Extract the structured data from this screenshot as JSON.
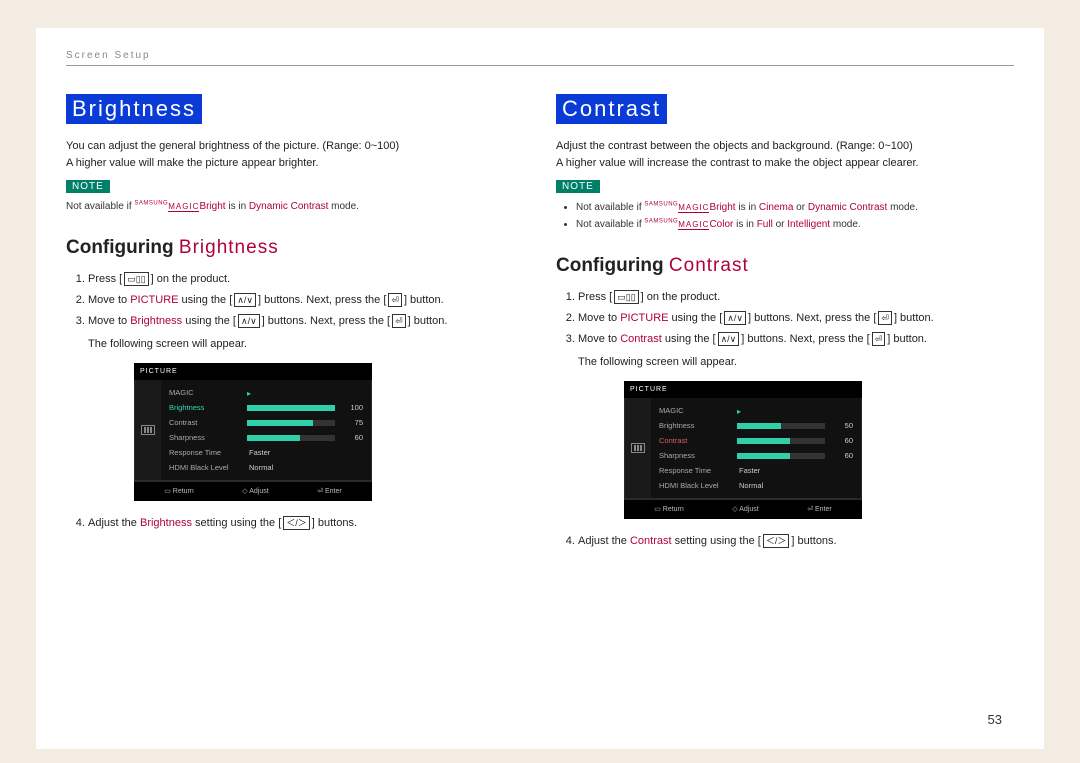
{
  "breadcrumb": "Screen Setup",
  "page_number": "53",
  "left": {
    "title": "Brightness",
    "desc1": "You can adjust the general brightness of the picture. (Range: 0~100)",
    "desc2": "A higher value will make the picture appear brighter.",
    "note_label": "NOTE",
    "note_prefix": "Not available if ",
    "note_samsung": "SAMSUNG",
    "note_magic": "MAGIC",
    "note_bright": "Bright",
    "note_mid": " is in ",
    "note_mode1": "Dynamic Contrast",
    "note_suffix": " mode.",
    "subhead_cfg": "Configuring ",
    "subhead_acc": "Brightness",
    "step1a": "Press [",
    "step1b": "] on the product.",
    "step2a": "Move to ",
    "step2_picture": "PICTURE",
    "step2b": " using the [",
    "step2c": "] buttons. Next, press the [",
    "step2d": "] button.",
    "step3a": "Move to ",
    "step3_target": "Brightness",
    "step3b": " using the [",
    "step3c": "] buttons. Next, press the [",
    "step3d": "] button.",
    "step3_sub": "The following screen will appear.",
    "step4a": "Adjust the ",
    "step4_target": "Brightness",
    "step4b": " setting using the [",
    "step4c": "] buttons.",
    "osd": {
      "header": "PICTURE",
      "rows": [
        {
          "label": "MAGIC",
          "type": "arrow"
        },
        {
          "label": "Brightness",
          "type": "bar",
          "value": 100,
          "highlight": true
        },
        {
          "label": "Contrast",
          "type": "bar",
          "value": 75
        },
        {
          "label": "Sharpness",
          "type": "bar",
          "value": 60
        },
        {
          "label": "Response Time",
          "type": "text",
          "text": "Faster"
        },
        {
          "label": "HDMI Black Level",
          "type": "text",
          "text": "Normal"
        }
      ],
      "footer": [
        "Return",
        "Adjust",
        "Enter"
      ]
    }
  },
  "right": {
    "title": "Contrast",
    "desc1": "Adjust the contrast between the objects and background. (Range: 0~100)",
    "desc2": "A higher value will increase the contrast to make the object appear clearer.",
    "note_label": "NOTE",
    "notes": [
      {
        "prefix": "Not available if ",
        "samsung": "SAMSUNG",
        "magic": "MAGIC",
        "tail": "Bright",
        "mid": " is in ",
        "m1": "Cinema",
        "or": " or ",
        "m2": "Dynamic Contrast",
        "suffix": " mode."
      },
      {
        "prefix": "Not available if ",
        "samsung": "SAMSUNG",
        "magic": "MAGIC",
        "tail": "Color",
        "mid": " is in ",
        "m1": "Full",
        "or": " or ",
        "m2": "Intelligent",
        "suffix": " mode."
      }
    ],
    "subhead_cfg": "Configuring ",
    "subhead_acc": "Contrast",
    "step1a": "Press [",
    "step1b": "] on the product.",
    "step2a": "Move to ",
    "step2_picture": "PICTURE",
    "step2b": " using the [",
    "step2c": "] buttons. Next, press the [",
    "step2d": "] button.",
    "step3a": "Move to ",
    "step3_target": "Contrast",
    "step3b": " using the [",
    "step3c": "] buttons. Next, press the [",
    "step3d": "] button.",
    "step3_sub": "The following screen will appear.",
    "step4a": "Adjust the ",
    "step4_target": "Contrast",
    "step4b": " setting using the [",
    "step4c": "] buttons.",
    "osd": {
      "header": "PICTURE",
      "rows": [
        {
          "label": "MAGIC",
          "type": "arrow"
        },
        {
          "label": "Brightness",
          "type": "bar",
          "value": 50
        },
        {
          "label": "Contrast",
          "type": "bar",
          "value": 60,
          "hot": true
        },
        {
          "label": "Sharpness",
          "type": "bar",
          "value": 60
        },
        {
          "label": "Response Time",
          "type": "text",
          "text": "Faster"
        },
        {
          "label": "HDMI Black Level",
          "type": "text",
          "text": "Normal"
        }
      ],
      "footer": [
        "Return",
        "Adjust",
        "Enter"
      ]
    }
  }
}
